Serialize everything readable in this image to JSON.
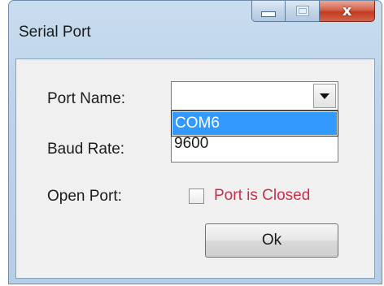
{
  "window": {
    "title": "Serial Port",
    "close_glyph": "x"
  },
  "form": {
    "port_name_label": "Port Name:",
    "port_name_value": "",
    "port_options": [
      "COM6"
    ],
    "highlighted_option": "COM6",
    "baud_rate_label": "Baud Rate:",
    "baud_rate_value": "9600",
    "open_port_label": "Open Port:",
    "open_port_checked": false,
    "open_port_status": "Port is Closed",
    "ok_label": "Ok"
  },
  "colors": {
    "status_text": "#c8304a",
    "selection": "#3399ff"
  },
  "icons": {
    "minimize": "minimize-icon",
    "maximize": "maximize-icon",
    "close": "close-icon",
    "dropdown_arrow": "chevron-down-icon"
  }
}
